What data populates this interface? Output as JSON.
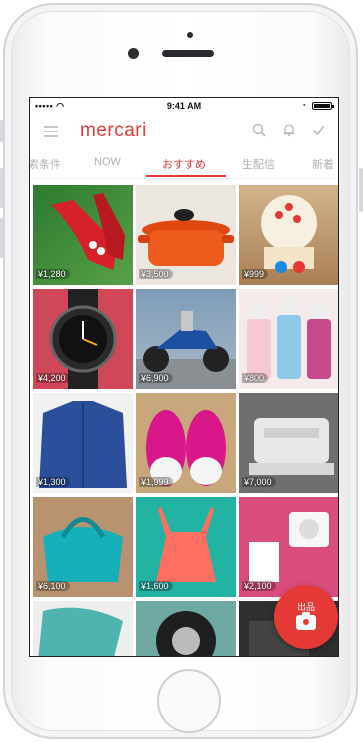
{
  "status_bar": {
    "signal": "••••• ",
    "time": "9:41 AM"
  },
  "app": {
    "logo": "mercari"
  },
  "icons": {
    "menu": "hamburger-icon",
    "search": "search-icon",
    "notifications": "bell-icon",
    "todo": "check-icon"
  },
  "tabs": [
    {
      "label": "索条件"
    },
    {
      "label": "NOW"
    },
    {
      "label": "おすすめ"
    },
    {
      "label": "生配信"
    },
    {
      "label": "新着"
    }
  ],
  "active_tab": "おすすめ",
  "items": [
    {
      "price": "¥1,280",
      "subject": "red shoes",
      "color": "#3c8a3a"
    },
    {
      "price": "¥3,500",
      "subject": "orange pot",
      "color": "#e8e3da"
    },
    {
      "price": "¥999",
      "subject": "cake toy",
      "color": "#c8a070"
    },
    {
      "price": "¥4,200",
      "subject": "watch",
      "color": "#d24a5a"
    },
    {
      "price": "¥6,900",
      "subject": "scooter",
      "color": "#6d8ca8"
    },
    {
      "price": "¥800",
      "subject": "soaps",
      "color": "#f2e8ea"
    },
    {
      "price": "¥1,300",
      "subject": "denim shirt",
      "color": "#2b4f9a"
    },
    {
      "price": "¥1,999",
      "subject": "pink sneakers",
      "color": "#c2a27c"
    },
    {
      "price": "¥7,000",
      "subject": "printer",
      "color": "#8c8c8c"
    },
    {
      "price": "¥6,100",
      "subject": "teal bag",
      "color": "#b58a68"
    },
    {
      "price": "¥1,600",
      "subject": "coral top",
      "color": "#2eb7a6"
    },
    {
      "price": "¥2,100",
      "subject": "cosmetics",
      "color": "#e05a8a"
    },
    {
      "price": "",
      "subject": "teal item",
      "color": "#3c8c8a"
    },
    {
      "price": "",
      "subject": "tire",
      "color": "#1f1f1f"
    },
    {
      "price": "",
      "subject": "item",
      "color": "#3a3a3a"
    }
  ],
  "fab": {
    "label": "出品"
  }
}
